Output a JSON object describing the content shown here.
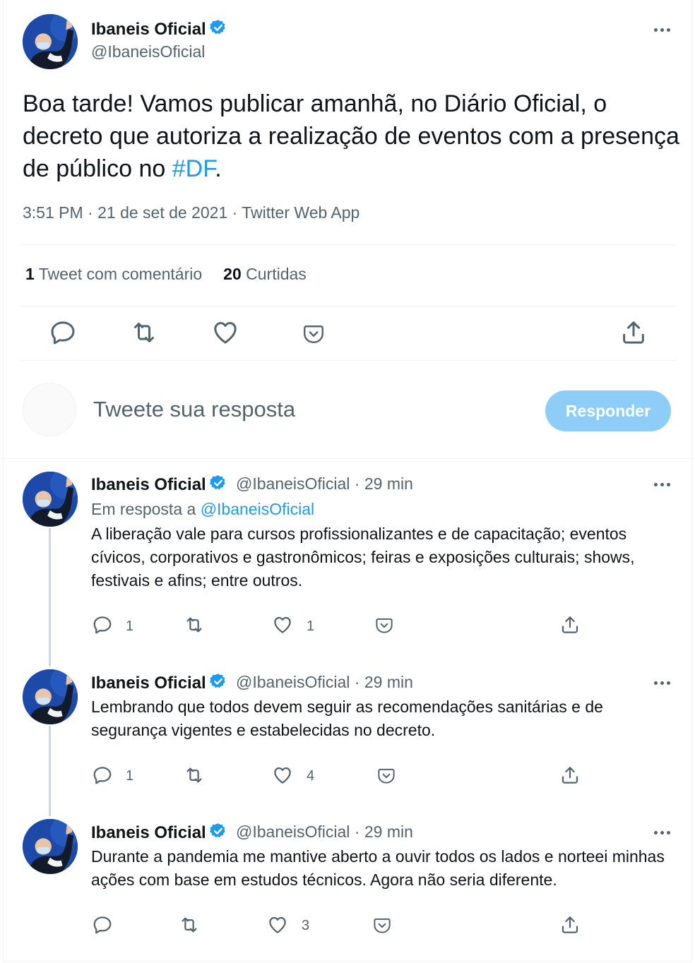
{
  "main_tweet": {
    "display_name": "Ibaneis Oficial",
    "handle": "@IbaneisOficial",
    "text_before": "Boa tarde! Vamos publicar amanhã, no Diário Oficial, o decreto que autoriza a realização de eventos com a presença de público no ",
    "hashtag": "#DF",
    "text_after": ".",
    "meta": "3:51 PM · 21 de set de 2021 · Twitter Web App",
    "quote_count": "1",
    "quote_label": "Tweet com comentário",
    "like_count": "20",
    "like_label": "Curtidas",
    "icons": [
      "reply-icon",
      "retweet-icon",
      "like-icon",
      "save-icon",
      "share-icon"
    ]
  },
  "reply_box": {
    "placeholder": "Tweete sua resposta",
    "button": "Responder"
  },
  "thread": [
    {
      "display_name": "Ibaneis Oficial",
      "handle_time": "@IbaneisOficial · 29 min",
      "reply_to_prefix": "Em resposta a ",
      "reply_to_handle": "@IbaneisOficial",
      "text": "A liberação vale para cursos profissionalizantes e de capacitação; eventos cívicos, corporativos e gastronômicos; feiras e exposições culturais; shows, festivais e afins; entre outros.",
      "reply_count": "1",
      "like_count": "1"
    },
    {
      "display_name": "Ibaneis Oficial",
      "handle_time": "@IbaneisOficial · 29 min",
      "text": "Lembrando que todos devem seguir as recomendações sanitárias e de segurança vigentes e estabelecidas no decreto.",
      "reply_count": "1",
      "like_count": "4"
    },
    {
      "display_name": "Ibaneis Oficial",
      "handle_time": "@IbaneisOficial · 29 min",
      "text": "Durante a pandemia me mantive aberto a ouvir todos os lados e norteei minhas ações com base em estudos técnicos. Agora não seria diferente.",
      "reply_count": "",
      "like_count": "3"
    }
  ],
  "colors": {
    "accent": "#1d9bf0",
    "secondary_text": "#536471",
    "button_disabled": "#8ecdf8"
  }
}
